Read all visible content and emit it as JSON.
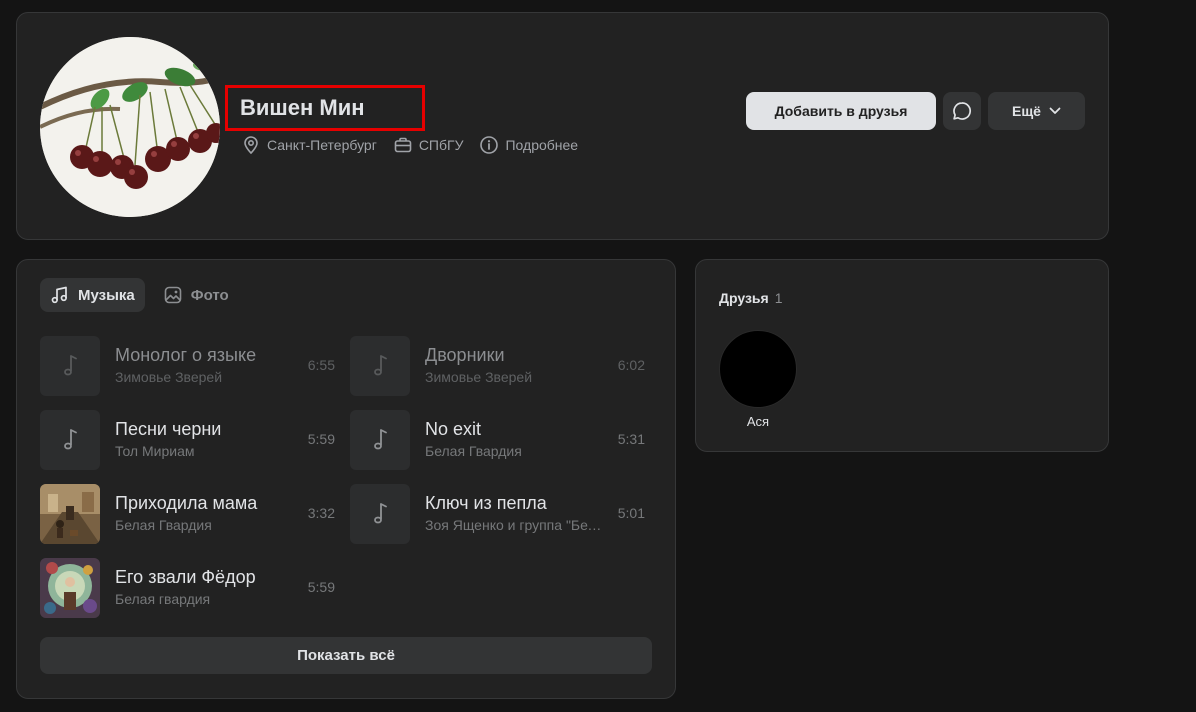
{
  "profile": {
    "name": "Вишен Мин",
    "city": "Санкт-Петербург",
    "university": "СПбГУ",
    "details": "Подробнее",
    "add_friend": "Добавить в друзья",
    "more": "Ещё"
  },
  "music": {
    "tabs": [
      {
        "label": "Музыка",
        "icon": "music-note-icon"
      },
      {
        "label": "Фото",
        "icon": "image-icon"
      }
    ],
    "tracks": [
      {
        "title": "Монолог о языке",
        "artist": "Зимовье Зверей",
        "duration": "6:55",
        "cover": "music-note-icon"
      },
      {
        "title": "Дворники",
        "artist": "Зимовье Зверей",
        "duration": "6:02",
        "cover": "music-note-icon"
      },
      {
        "title": "Песни черни",
        "artist": "Тол Мириам",
        "duration": "5:59",
        "cover": "music-note-icon"
      },
      {
        "title": "No exit",
        "artist": "Белая Гвардия",
        "duration": "5:31",
        "cover": "music-note-icon"
      },
      {
        "title": "Приходила мама",
        "artist": "Белая Гвардия",
        "duration": "3:32",
        "cover": "album-art"
      },
      {
        "title": "Ключ из пепла",
        "artist": "Зоя Ященко и группа \"Белая Гвардия\"",
        "duration": "5:01",
        "cover": "music-note-icon"
      },
      {
        "title": "Его звали Фёдор",
        "artist": "Белая гвардия",
        "duration": "5:59",
        "cover": "album-art"
      }
    ],
    "show_all": "Показать всё"
  },
  "friends": {
    "title": "Друзья",
    "count": "1",
    "items": [
      {
        "name": "Ася"
      }
    ]
  },
  "colors": {
    "background": "#141414",
    "card": "#222222",
    "highlight_box": "#e60000",
    "primary_button": "#e1e3e6"
  }
}
